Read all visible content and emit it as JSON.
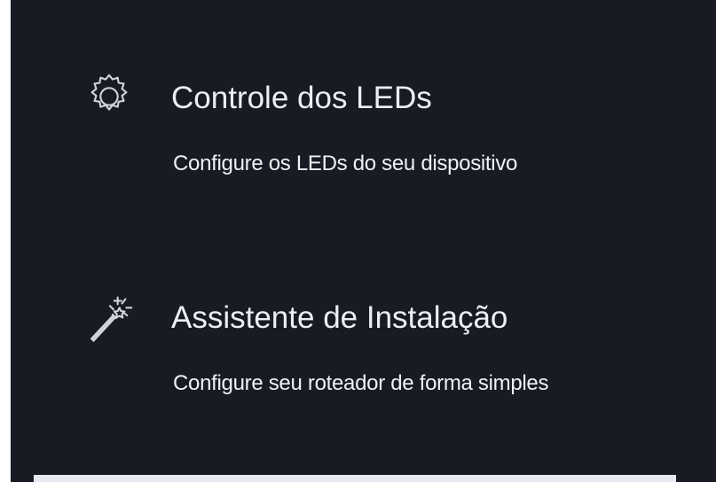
{
  "menu": {
    "items": [
      {
        "icon": "gear-icon",
        "title": "Controle dos LEDs",
        "description": "Configure os LEDs do seu dispositivo"
      },
      {
        "icon": "magic-wand-icon",
        "title": "Assistente de Instalação",
        "description": "Configure seu roteador de forma simples"
      }
    ]
  },
  "colors": {
    "panel_background": "#181b24",
    "text": "#eceef2",
    "icon": "#cfd3db",
    "bottom_bar": "#e8e9f0"
  }
}
